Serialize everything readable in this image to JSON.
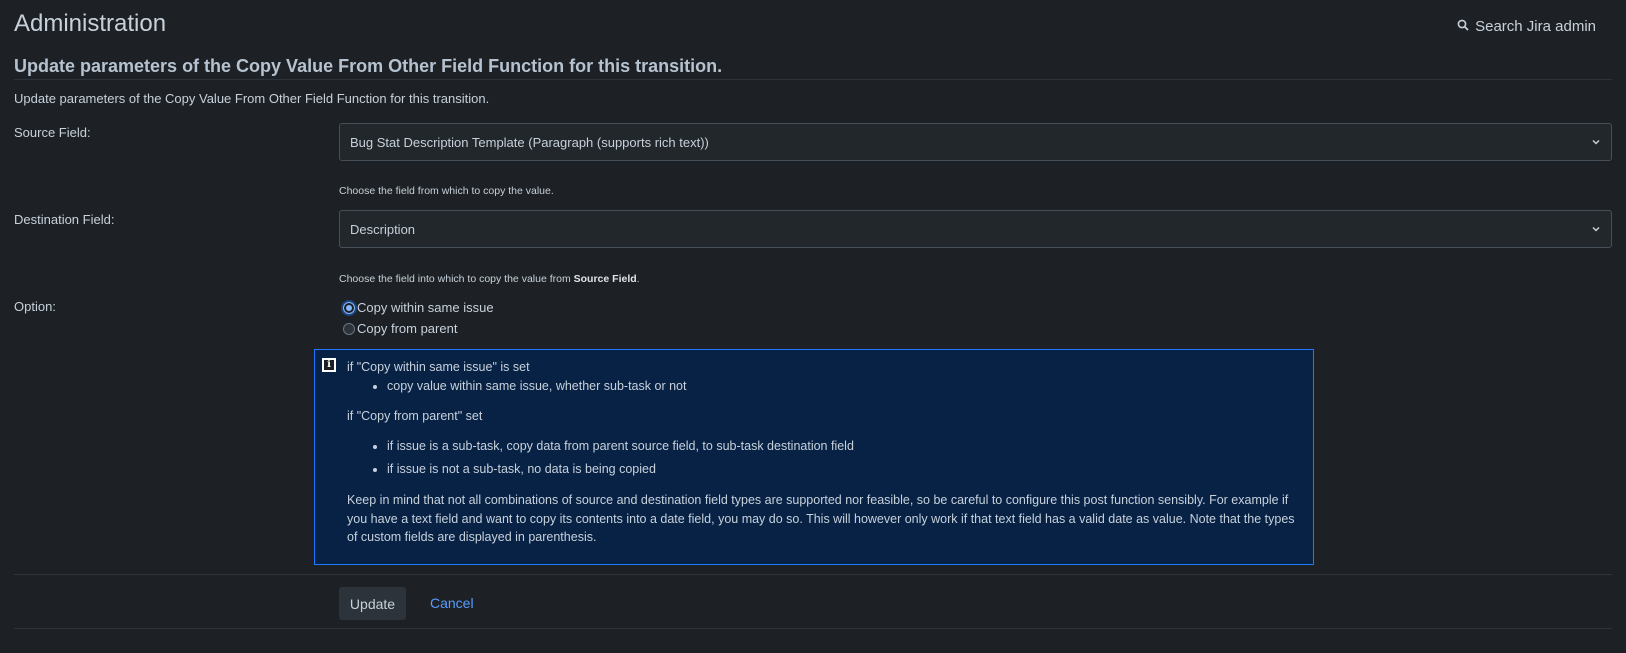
{
  "header": {
    "title": "Administration",
    "search_label": "Search Jira admin"
  },
  "section": {
    "title": "Update parameters of the Copy Value From Other Field Function for this transition.",
    "description": "Update parameters of the Copy Value From Other Field Function for this transition."
  },
  "form": {
    "source_label": "Source Field:",
    "source_value": "Bug Stat Description Template (Paragraph (supports rich text))",
    "source_help": "Choose the field from which to copy the value.",
    "dest_label": "Destination Field:",
    "dest_value": "Description",
    "dest_help_prefix": "Choose the field into which to copy the value from ",
    "dest_help_bold": "Source Field",
    "dest_help_suffix": ".",
    "option_label": "Option:",
    "options": [
      {
        "label": "Copy within same issue",
        "checked": true
      },
      {
        "label": "Copy from parent",
        "checked": false
      }
    ]
  },
  "info": {
    "heading1": "if \"Copy within same issue\" is set",
    "list1": [
      "copy value within same issue, whether sub-task or not"
    ],
    "heading2": "if \"Copy from parent\" set",
    "list2": [
      "if issue is a sub-task, copy data from parent source field, to sub-task destination field",
      "if issue is not a sub-task, no data is being copied"
    ],
    "note": "Keep in mind that not all combinations of source and destination field types are supported nor feasible, so be careful to configure this post function sensibly. For example if you have a text field and want to copy its contents into a date field, you may do so. This will however only work if that text field has a valid date as value. Note that the types of custom fields are displayed in parenthesis."
  },
  "actions": {
    "update_label": "Update",
    "cancel_label": "Cancel"
  },
  "colors": {
    "background": "#1d2125",
    "info_background": "#082245",
    "accent": "#1d7afc",
    "link": "#579dff"
  }
}
